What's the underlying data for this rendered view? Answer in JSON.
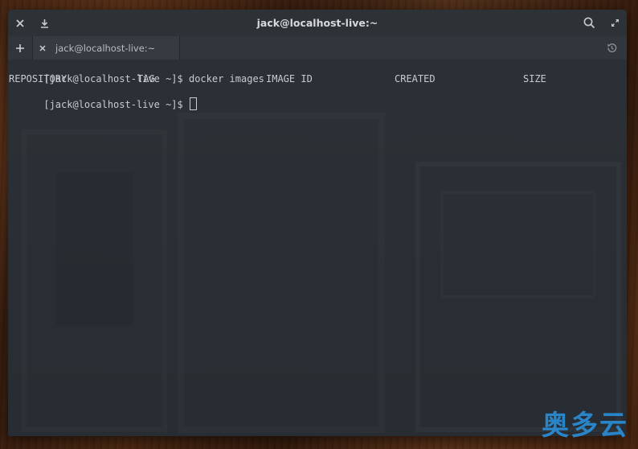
{
  "window": {
    "title": "jack@localhost-live:~"
  },
  "tabs": [
    {
      "label": "jack@localhost-live:~"
    }
  ],
  "icons": {
    "close": "close-icon",
    "download": "download-icon",
    "search": "search-icon",
    "maximize": "maximize-icon",
    "new_tab": "plus-icon",
    "tab_close": "close-icon",
    "history": "history-icon"
  },
  "terminal": {
    "line1": {
      "prompt": "[jack@localhost-live ~]$ ",
      "command": "docker images"
    },
    "headers": [
      "REPOSITORY",
      "TAG",
      "IMAGE ID",
      "CREATED",
      "SIZE"
    ],
    "line3": {
      "prompt": "[jack@localhost-live ~]$ "
    }
  },
  "colors": {
    "terminal_bg": "#272d32",
    "text": "#c8ccd0",
    "watermark": "#2a8fd8"
  },
  "watermark": {
    "text": "奥多云"
  }
}
